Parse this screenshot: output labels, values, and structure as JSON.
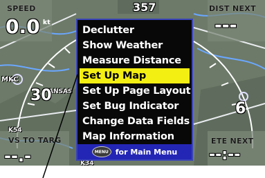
{
  "fields": {
    "speed": {
      "label": "SPEED",
      "value": "0.0",
      "unit": "kt"
    },
    "heading": {
      "value": "357"
    },
    "dist_next": {
      "label": "DIST NEXT",
      "value": "---"
    },
    "vs_to_targ": {
      "label": "VS TO TARG",
      "value": "--.-"
    },
    "ete_next": {
      "label": "ETE NEXT",
      "value": "--:--"
    }
  },
  "map": {
    "labels": [
      "MKC",
      "ANSAS",
      "K34",
      "K54",
      "30",
      "6"
    ]
  },
  "menu": {
    "items": [
      {
        "label": "Declutter",
        "selected": false
      },
      {
        "label": "Show Weather",
        "selected": false
      },
      {
        "label": "Measure Distance",
        "selected": false
      },
      {
        "label": "Set Up Map",
        "selected": true
      },
      {
        "label": "Set Up Page Layout",
        "selected": false
      },
      {
        "label": "Set Bug Indicator",
        "selected": false
      },
      {
        "label": "Change Data Fields",
        "selected": false
      },
      {
        "label": "Map Information",
        "selected": false
      }
    ],
    "footer_button": "MENU",
    "footer_text": "for Main Menu"
  },
  "colors": {
    "highlight": "#f4ef12",
    "menu_border": "#3a43b8",
    "footer": "#2326b4",
    "map_bg": "#697766"
  }
}
